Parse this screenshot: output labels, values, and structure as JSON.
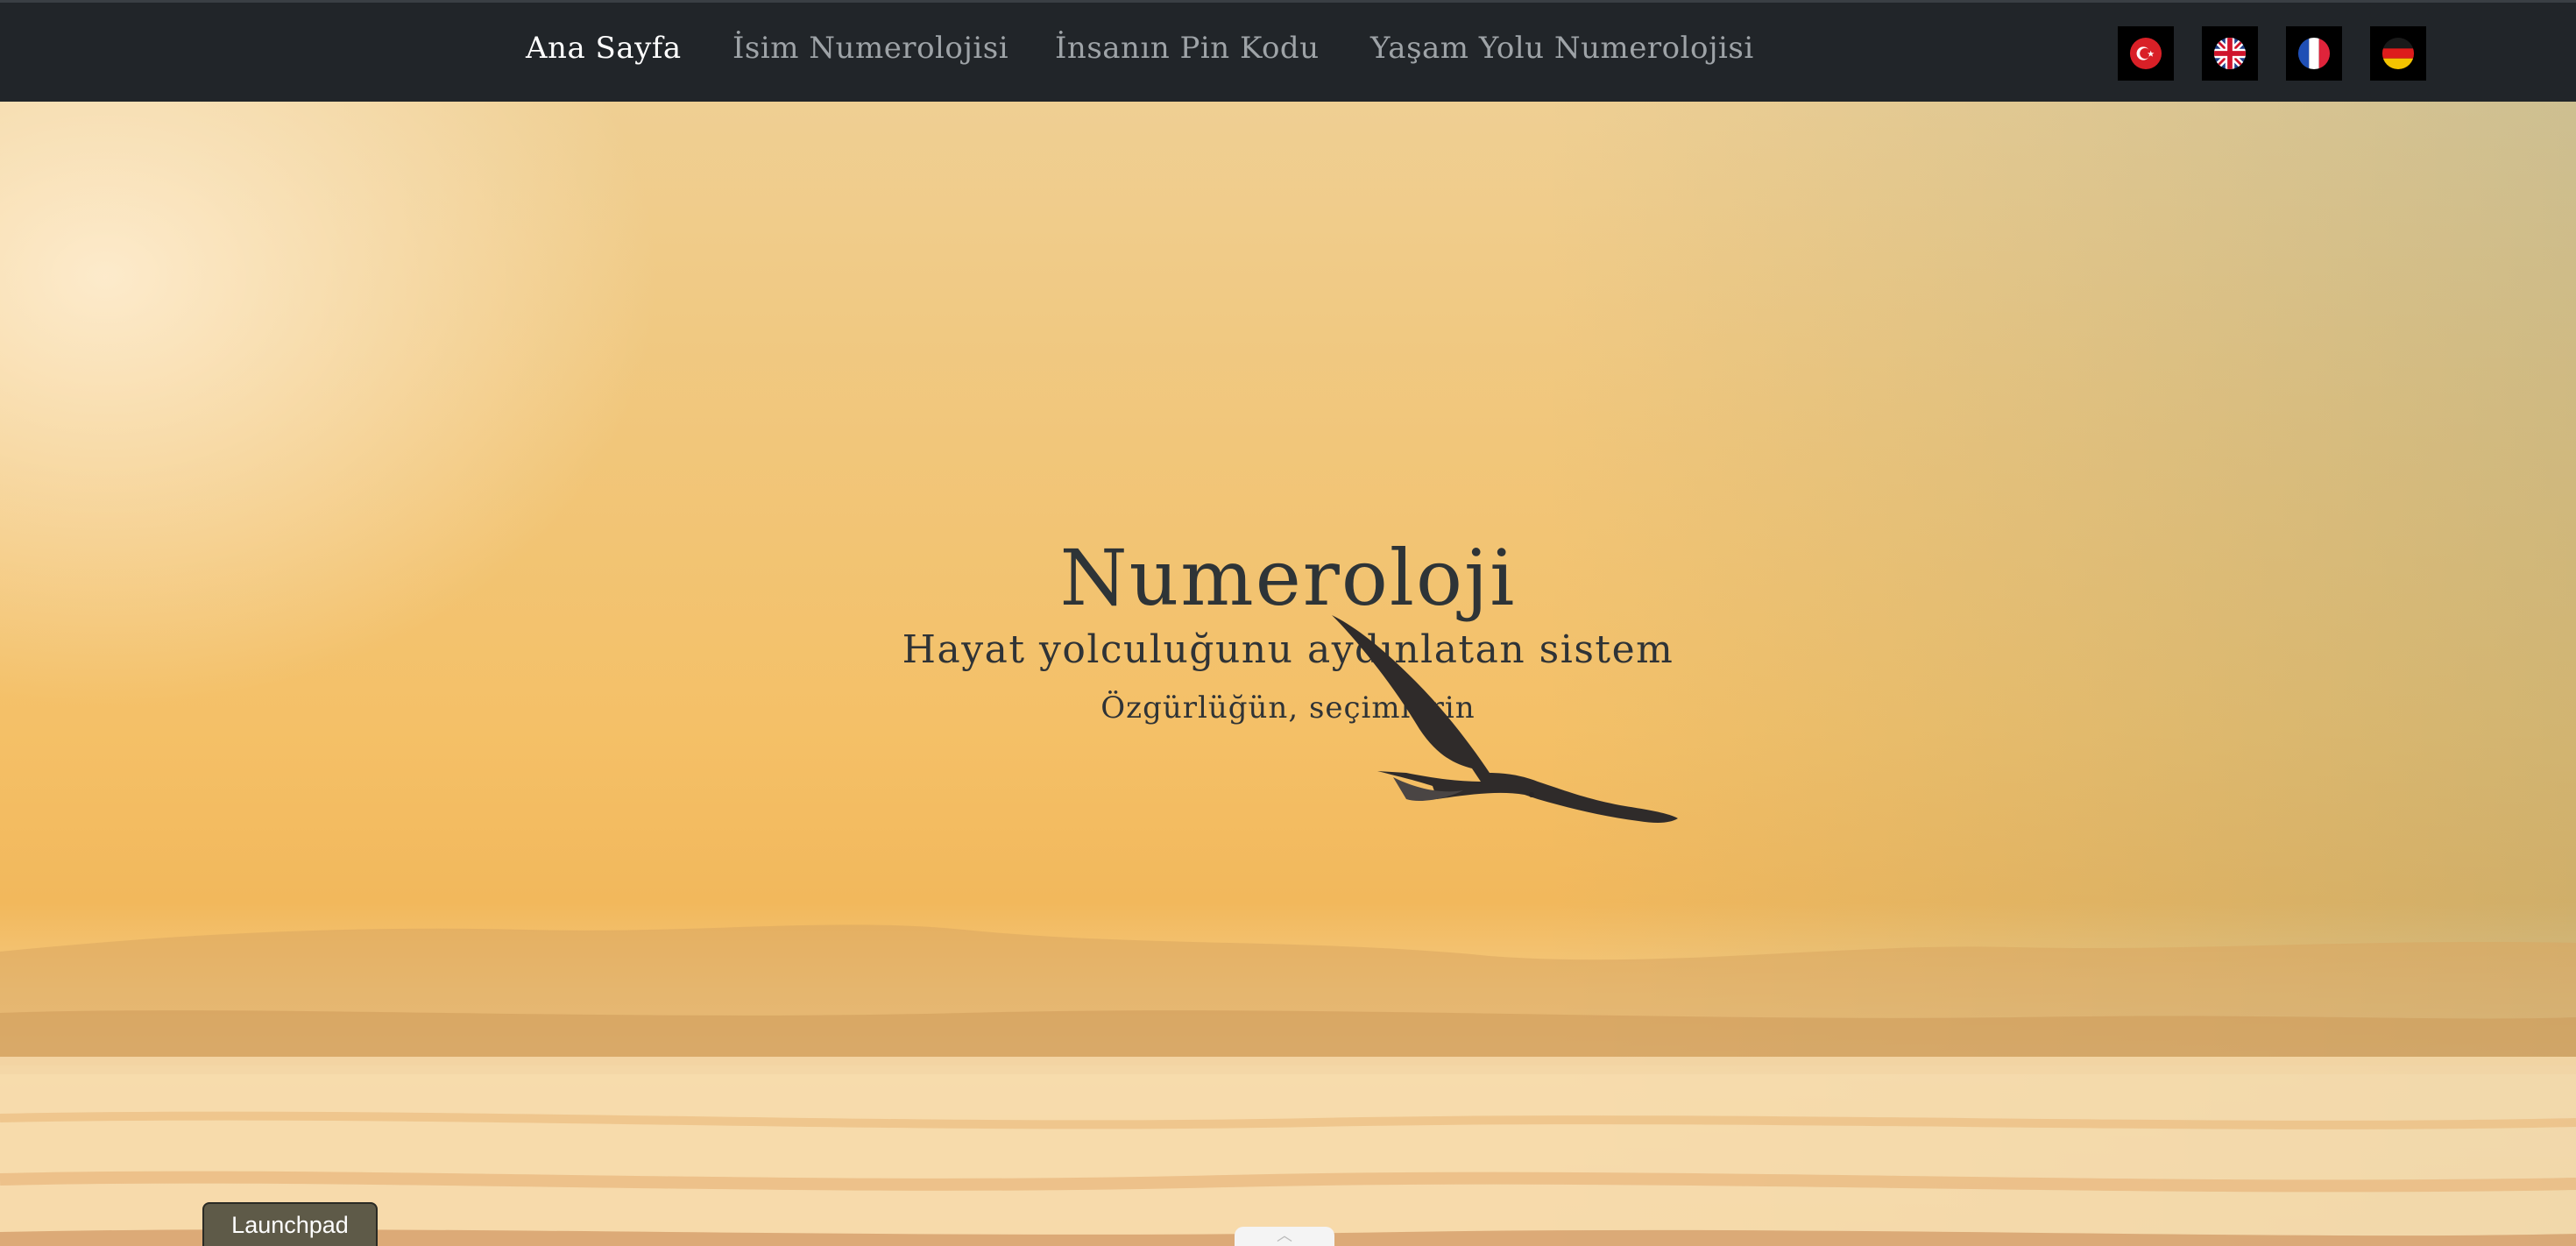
{
  "nav": {
    "links": [
      {
        "label": "Ana Sayfa",
        "active": true
      },
      {
        "label": "İsim Numerolojisi",
        "active": false
      },
      {
        "label": "İnsanın Pin Kodu",
        "active": false
      },
      {
        "label": "Yaşam Yolu Numerolojisi",
        "active": false
      }
    ],
    "languages": [
      {
        "icon": "turkey-flag-icon"
      },
      {
        "icon": "uk-flag-icon"
      },
      {
        "icon": "france-flag-icon"
      },
      {
        "icon": "germany-flag-icon"
      }
    ]
  },
  "hero": {
    "title": "Numeroloji",
    "subtitle": "Hayat yolculuğunu aydınlatan sistem",
    "tagline": "Özgürlüğün, seçimlerin"
  },
  "launchpad": {
    "label": "Launchpad"
  },
  "colors": {
    "navbar": "#212529",
    "nav_active": "#ffffff",
    "nav_inactive": "#9ea3a7",
    "hero_text": "#2e3437"
  }
}
